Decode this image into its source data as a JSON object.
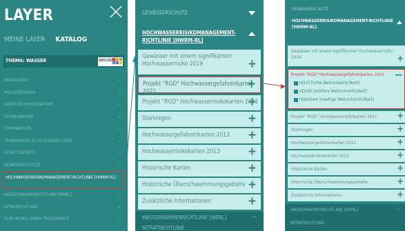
{
  "panel1": {
    "title": "LAYER",
    "tabs": [
      {
        "label": "MEINE LAYER"
      },
      {
        "label": "KATALOG"
      }
    ],
    "thema": "THEMA: WASSER",
    "wechseln": "WECHSELN",
    "items": [
      {
        "label": "BASISDATEN"
      },
      {
        "label": "MESSSTATIONEN"
      },
      {
        "label": "OBERFLÄCHENGEWÄSSER"
      },
      {
        "label": "GRUNDWASSER"
      },
      {
        "label": "TRINKWASSER"
      },
      {
        "label": "TRINKWASSER SCHUTZZONEN (ZPS)"
      },
      {
        "label": "SCHUTZGEBIETE"
      },
      {
        "label": "GEWÄSSERSCHUTZ"
      },
      {
        "label": "HOCHWASSERRISIKOMANAGEMENT-RICHTLINIE [HWRM-RL]"
      },
      {
        "label": "WASSERRAHMENRICHTLINIE [WRRL]"
      },
      {
        "label": "NITRATRICHTLINIE"
      },
      {
        "label": "PLAN IM FALL EINER TROCKENHEIT"
      }
    ]
  },
  "panel2": {
    "section": "GEWÄSSERSCHUTZ",
    "subsection": "HOCHWASSERRISIKOMANAGEMENT-RICHTLINIE [HWRM-RL]",
    "items": [
      {
        "label": "Gewässer mit einem signifikanten Hochwasserrisiko 2019"
      },
      {
        "label": "Projekt \"RGD\" Hochwassergefahrenkarten 2021"
      },
      {
        "label": "Projekt \"RGD\" Hochwasserrisikokarten 2021"
      },
      {
        "label": "Starkregen"
      },
      {
        "label": "Hochwassergefahrenkarten 2013"
      },
      {
        "label": "Hochwasserrisikokarten 2013"
      },
      {
        "label": "Historische Karten"
      },
      {
        "label": "Historische Überschwemmungsgebiete"
      },
      {
        "label": "Zusätzliche Informationen"
      }
    ],
    "bottom": [
      {
        "label": "WASSERRAHMENRICHTLINIE [WRRL]"
      },
      {
        "label": "NITRATRICHTLINIE"
      }
    ]
  },
  "panel3": {
    "section": "GEWÄSSERSCHUTZ",
    "subsection": "HOCHWASSERRISIKOMANAGEMENT-RICHTLINIE [HWRM-RL]",
    "item_top": "Gewässer mit einem signifikanten Hochwasserrisiko 2019",
    "expanded": "Projekt \"RGD\" Hochwassergefahrenkarten 2021",
    "subitems": [
      {
        "label": "HQ10 [hohe Wahrscheinlichkeit]"
      },
      {
        "label": "HQ100 [mittlere Wahrscheinlichkeit]"
      },
      {
        "label": "HQextrem [niedrige Wahrscheinlichkeit]"
      }
    ],
    "items": [
      {
        "label": "Projekt \"RGD\" Hochwasserrisikokarten 2021"
      },
      {
        "label": "Starkregen"
      },
      {
        "label": "Hochwassergefahrenkarten 2013"
      },
      {
        "label": "Hochwasserrisikokarten 2013"
      },
      {
        "label": "Historische Karten"
      },
      {
        "label": "Historische Überschwemmungsgebiete"
      },
      {
        "label": "Zusätzliche Informationen"
      }
    ],
    "bottom": [
      {
        "label": "WASSERRAHMENRICHTLINIE [WRRL]"
      },
      {
        "label": "NITRATRICHTLINIE"
      }
    ]
  },
  "colors": {
    "teal": "#2a8583",
    "dark_teal": "#1f6f6d",
    "light": "#c7ecec",
    "red": "#d23a3a"
  }
}
